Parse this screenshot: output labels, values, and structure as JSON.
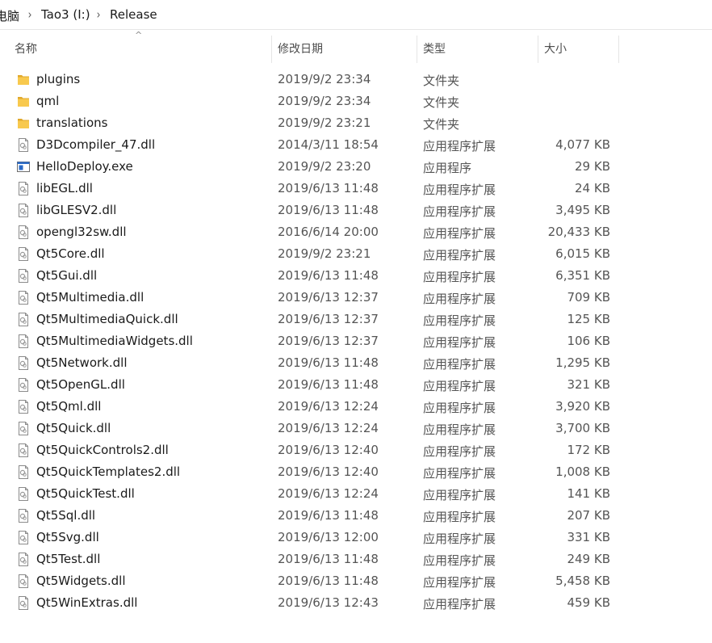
{
  "breadcrumb": {
    "items": [
      "电脑",
      "Tao3 (I:)",
      "Release"
    ],
    "separator": "›"
  },
  "columns": {
    "name": "名称",
    "date": "修改日期",
    "type": "类型",
    "size": "大小",
    "sort_indicator": "^"
  },
  "files": [
    {
      "name": "plugins",
      "date": "2019/9/2 23:34",
      "type": "文件夹",
      "size": "",
      "icon": "folder-icon"
    },
    {
      "name": "qml",
      "date": "2019/9/2 23:34",
      "type": "文件夹",
      "size": "",
      "icon": "folder-icon"
    },
    {
      "name": "translations",
      "date": "2019/9/2 23:21",
      "type": "文件夹",
      "size": "",
      "icon": "folder-icon"
    },
    {
      "name": "D3Dcompiler_47.dll",
      "date": "2014/3/11 18:54",
      "type": "应用程序扩展",
      "size": "4,077 KB",
      "icon": "dll-file-icon"
    },
    {
      "name": "HelloDeploy.exe",
      "date": "2019/9/2 23:20",
      "type": "应用程序",
      "size": "29 KB",
      "icon": "exe-file-icon"
    },
    {
      "name": "libEGL.dll",
      "date": "2019/6/13 11:48",
      "type": "应用程序扩展",
      "size": "24 KB",
      "icon": "dll-file-icon"
    },
    {
      "name": "libGLESV2.dll",
      "date": "2019/6/13 11:48",
      "type": "应用程序扩展",
      "size": "3,495 KB",
      "icon": "dll-file-icon"
    },
    {
      "name": "opengl32sw.dll",
      "date": "2016/6/14 20:00",
      "type": "应用程序扩展",
      "size": "20,433 KB",
      "icon": "dll-file-icon"
    },
    {
      "name": "Qt5Core.dll",
      "date": "2019/9/2 23:21",
      "type": "应用程序扩展",
      "size": "6,015 KB",
      "icon": "dll-file-icon"
    },
    {
      "name": "Qt5Gui.dll",
      "date": "2019/6/13 11:48",
      "type": "应用程序扩展",
      "size": "6,351 KB",
      "icon": "dll-file-icon"
    },
    {
      "name": "Qt5Multimedia.dll",
      "date": "2019/6/13 12:37",
      "type": "应用程序扩展",
      "size": "709 KB",
      "icon": "dll-file-icon"
    },
    {
      "name": "Qt5MultimediaQuick.dll",
      "date": "2019/6/13 12:37",
      "type": "应用程序扩展",
      "size": "125 KB",
      "icon": "dll-file-icon"
    },
    {
      "name": "Qt5MultimediaWidgets.dll",
      "date": "2019/6/13 12:37",
      "type": "应用程序扩展",
      "size": "106 KB",
      "icon": "dll-file-icon"
    },
    {
      "name": "Qt5Network.dll",
      "date": "2019/6/13 11:48",
      "type": "应用程序扩展",
      "size": "1,295 KB",
      "icon": "dll-file-icon"
    },
    {
      "name": "Qt5OpenGL.dll",
      "date": "2019/6/13 11:48",
      "type": "应用程序扩展",
      "size": "321 KB",
      "icon": "dll-file-icon"
    },
    {
      "name": "Qt5Qml.dll",
      "date": "2019/6/13 12:24",
      "type": "应用程序扩展",
      "size": "3,920 KB",
      "icon": "dll-file-icon"
    },
    {
      "name": "Qt5Quick.dll",
      "date": "2019/6/13 12:24",
      "type": "应用程序扩展",
      "size": "3,700 KB",
      "icon": "dll-file-icon"
    },
    {
      "name": "Qt5QuickControls2.dll",
      "date": "2019/6/13 12:40",
      "type": "应用程序扩展",
      "size": "172 KB",
      "icon": "dll-file-icon"
    },
    {
      "name": "Qt5QuickTemplates2.dll",
      "date": "2019/6/13 12:40",
      "type": "应用程序扩展",
      "size": "1,008 KB",
      "icon": "dll-file-icon"
    },
    {
      "name": "Qt5QuickTest.dll",
      "date": "2019/6/13 12:24",
      "type": "应用程序扩展",
      "size": "141 KB",
      "icon": "dll-file-icon"
    },
    {
      "name": "Qt5Sql.dll",
      "date": "2019/6/13 11:48",
      "type": "应用程序扩展",
      "size": "207 KB",
      "icon": "dll-file-icon"
    },
    {
      "name": "Qt5Svg.dll",
      "date": "2019/6/13 12:00",
      "type": "应用程序扩展",
      "size": "331 KB",
      "icon": "dll-file-icon"
    },
    {
      "name": "Qt5Test.dll",
      "date": "2019/6/13 11:48",
      "type": "应用程序扩展",
      "size": "249 KB",
      "icon": "dll-file-icon"
    },
    {
      "name": "Qt5Widgets.dll",
      "date": "2019/6/13 11:48",
      "type": "应用程序扩展",
      "size": "5,458 KB",
      "icon": "dll-file-icon"
    },
    {
      "name": "Qt5WinExtras.dll",
      "date": "2019/6/13 12:43",
      "type": "应用程序扩展",
      "size": "459 KB",
      "icon": "dll-file-icon"
    }
  ],
  "colors": {
    "folder": "#f8c94e",
    "folder_dark": "#e1a92c",
    "exe_blue": "#2a6ac7"
  }
}
